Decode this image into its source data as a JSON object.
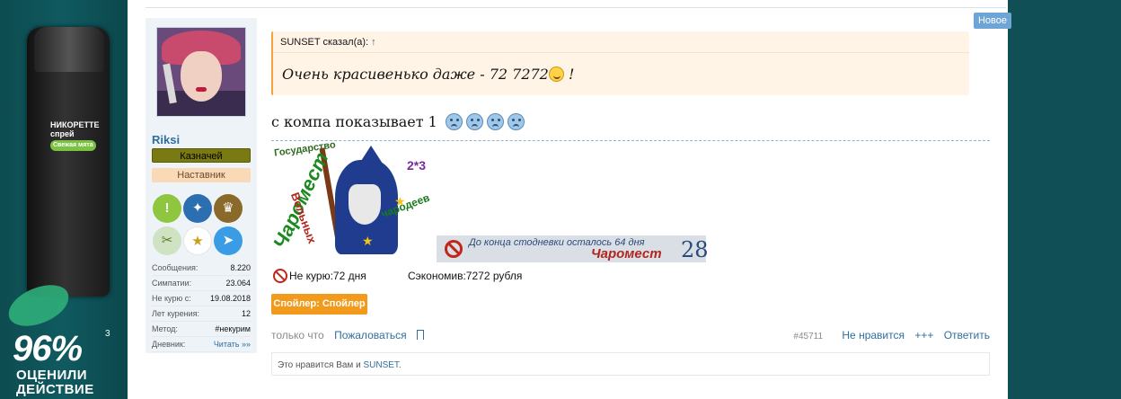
{
  "ad": {
    "brand": "НИКОРЕТТЕ",
    "sub": "спрей",
    "tag": "Свежая мята",
    "percent": "96%",
    "sup": "3",
    "line1": "ОЦЕНИЛИ",
    "line2": "ДЕЙСТВИЕ"
  },
  "badge": {
    "new": "Новое"
  },
  "user": {
    "name": "Riksi",
    "role1": "Казначей",
    "role2": "Наставник",
    "stats": [
      {
        "k": "Сообщения:",
        "v": "8.220"
      },
      {
        "k": "Симпатии:",
        "v": "23.064"
      },
      {
        "k": "Не курю с:",
        "v": "19.08.2018"
      },
      {
        "k": "Лет курения:",
        "v": "12"
      },
      {
        "k": "Метод:",
        "v": "#некурим"
      },
      {
        "k": "Дневник:",
        "v": "Читать »»"
      }
    ]
  },
  "quote": {
    "author": "SUNSET сказал(а):",
    "arrow": "↑",
    "text": "Очень красивенько даже - 72 7272",
    "tail": "!"
  },
  "message": {
    "text": "с компа показывает 1"
  },
  "signature": {
    "logo_t1": "Государство",
    "logo_t2": "Чаромест",
    "logo_t3": "Вольных",
    "logo_t4": "чародеев",
    "logo_t5": "2*3",
    "counter_text": "До конца стодневки осталось 64 дня",
    "counter_name": "Чаромест",
    "counter_num": "28",
    "nokur": "Не курю:72 дня",
    "saved": "Сэкономив:7272 рубля"
  },
  "spoiler": {
    "label": "Спойлер: Спойлер"
  },
  "footer": {
    "time": "только что",
    "report": "Пожаловаться",
    "post_num": "#45711",
    "dislike": "Не нравится",
    "plus": "+++",
    "reply": "Ответить"
  },
  "likes": {
    "prefix": "Это нравится Вам и ",
    "user": "SUNSET",
    "suffix": "."
  }
}
